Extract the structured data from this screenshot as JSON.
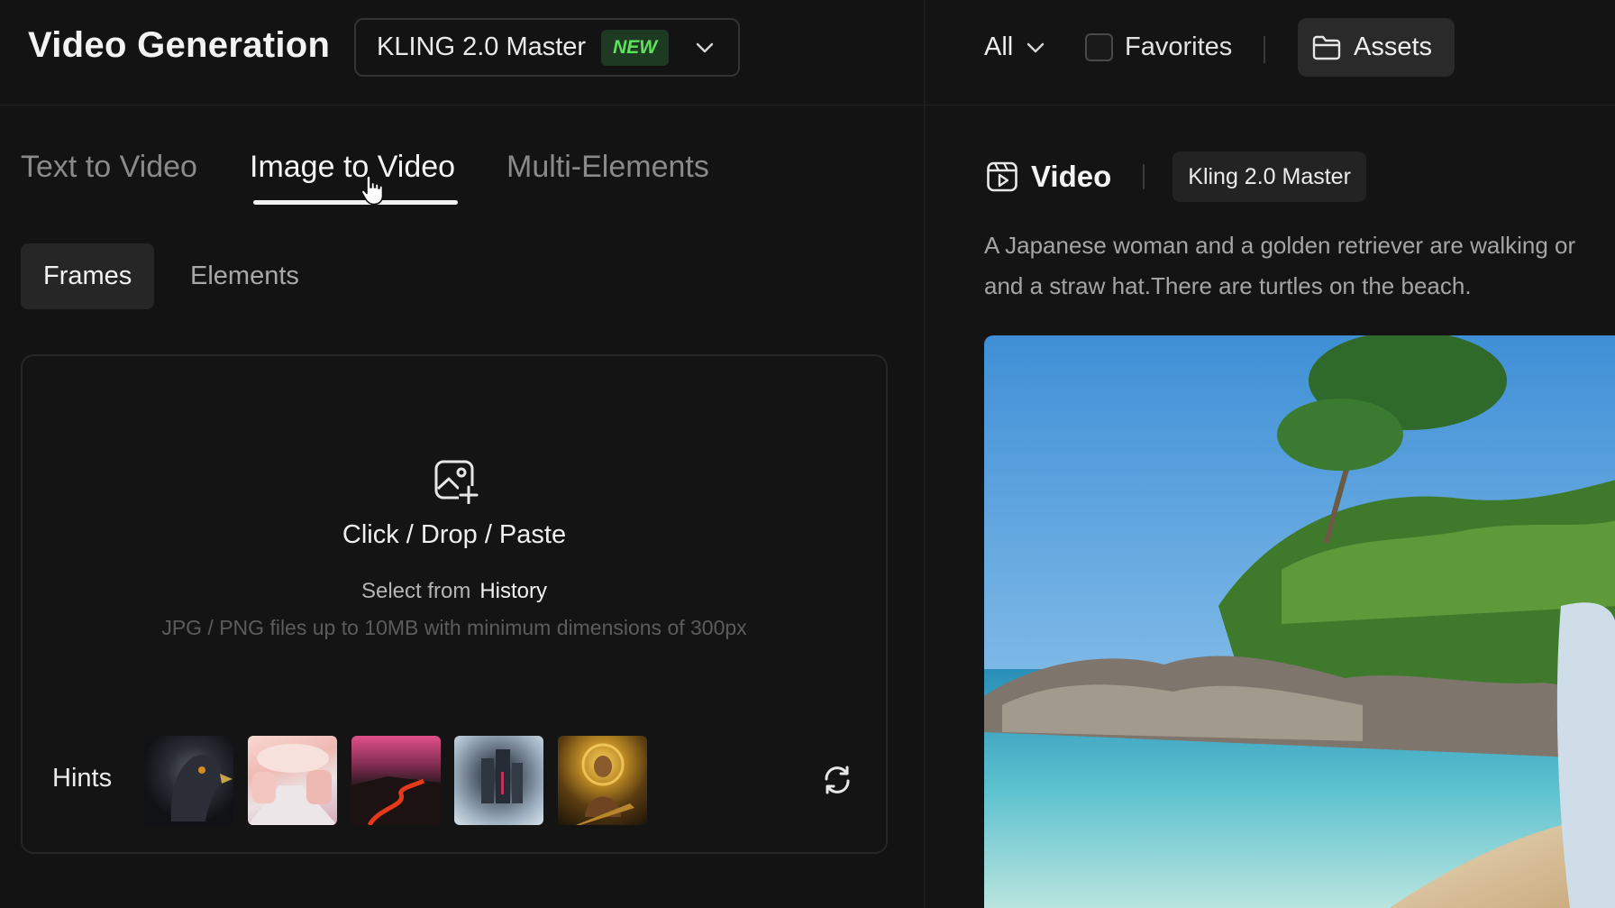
{
  "header": {
    "title": "Video Generation",
    "model": {
      "name": "KLING 2.0 Master",
      "badge": "NEW"
    }
  },
  "mode_tabs": [
    {
      "label": "Text to Video",
      "active": false
    },
    {
      "label": "Image to Video",
      "active": true
    },
    {
      "label": "Multi-Elements",
      "active": false
    }
  ],
  "sub_tabs": [
    {
      "label": "Frames",
      "active": true
    },
    {
      "label": "Elements",
      "active": false
    }
  ],
  "upload": {
    "main": "Click / Drop / Paste",
    "select_prefix": "Select from",
    "select_link": "History",
    "note": "JPG / PNG files up to 10MB with minimum dimensions of 300px"
  },
  "hints": {
    "label": "Hints",
    "thumbnails": [
      "eagle",
      "pink-street",
      "volcano",
      "misty-city",
      "golden-woman"
    ]
  },
  "right_toolbar": {
    "filter": "All",
    "favorites": "Favorites",
    "assets": "Assets"
  },
  "result": {
    "type_label": "Video",
    "model_chip": "Kling 2.0 Master",
    "prompt_line1": "A Japanese woman and a golden retriever are walking or",
    "prompt_line2": "and a straw hat.There are turtles on the beach."
  },
  "colors": {
    "background": "#131313",
    "badge_bg": "#1f3a22",
    "badge_text": "#5ee25e",
    "active_text": "#f4f4f4",
    "inactive_text": "#8a8a8a"
  }
}
